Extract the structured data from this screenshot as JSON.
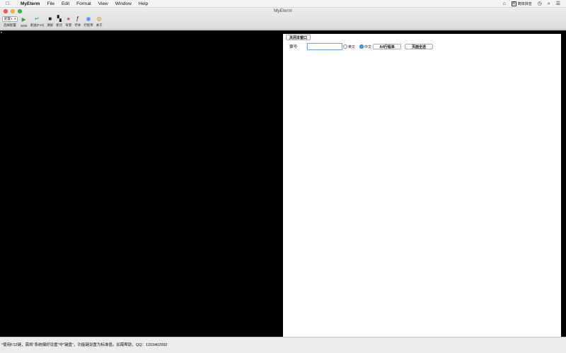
{
  "menubar": {
    "app_name": "MyEterm",
    "menus": [
      "File",
      "Edit",
      "Format",
      "View",
      "Window",
      "Help"
    ],
    "ime_label": "简体拼音",
    "ime_icon_char": "简"
  },
  "window": {
    "title": "MyEterm"
  },
  "toolbar": {
    "config_select_value": "配置1",
    "config_select_label": "选择配置",
    "items": [
      {
        "icon": "play-icon",
        "glyph": "▶",
        "color": "#2aa84a",
        "label": "SOE"
      },
      {
        "icon": "enter-icon",
        "glyph": "↵",
        "color": "#2aa84a",
        "label": "发送(F12)"
      },
      {
        "icon": "clear-screen-icon",
        "glyph": "■",
        "color": "#222222",
        "label": "清屏"
      },
      {
        "icon": "new-page-icon",
        "glyph": "▚",
        "color": "#222222",
        "label": "新页"
      },
      {
        "icon": "background-icon",
        "glyph": "●",
        "color": "#d9534f",
        "label": "背景"
      },
      {
        "icon": "font-icon",
        "glyph": "ƒ",
        "color": "#222222",
        "label": "字体"
      },
      {
        "icon": "itinerary-icon",
        "glyph": "◉",
        "color": "#3d8df5",
        "label": "行程单"
      },
      {
        "icon": "about-icon",
        "glyph": "◍",
        "color": "#c7a92b",
        "label": "关于"
      }
    ]
  },
  "terminal": {
    "cursor_char": "▸"
  },
  "panel": {
    "close_button_label": "关闭本窗口",
    "ticket_label": "票号:",
    "ticket_value": "",
    "radio_english_label": "英文",
    "radio_chinese_label": "中文",
    "selected_language": "中文",
    "a4_button_label": "A4行程单",
    "select_all_button_label": "页面全选"
  },
  "status": {
    "text": "*使用F12键，需将\"系统偏好设置\"中\"键盘\"，功能键设置为标准值。如需帮助，QQ：1203402992"
  },
  "colors": {
    "terminal_bg": "#000000",
    "focus_ring": "#6aa3e6",
    "radio_selected": "#3d8df5"
  }
}
